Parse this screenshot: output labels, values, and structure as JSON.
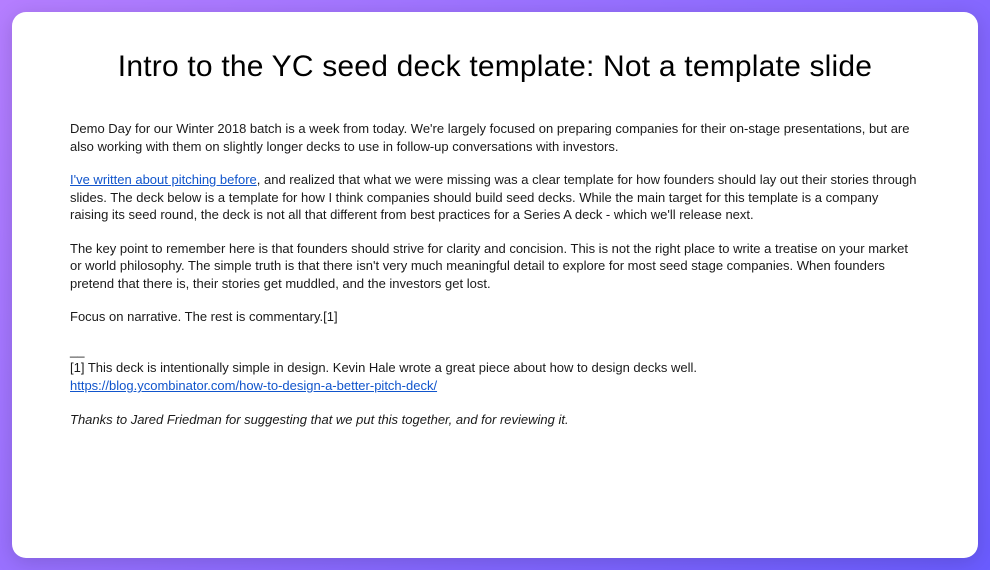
{
  "title": "Intro to the YC seed deck template: Not a template slide",
  "para1": "Demo Day for our Winter 2018 batch is a week from today. We're largely focused on preparing companies for their on-stage presentations, but are also working with them on slightly longer decks to use in follow-up conversations with investors.",
  "para2_link": "I've written about pitching before",
  "para2_rest": ", and realized that what we were missing was a clear template for how founders should lay out their stories through slides. The deck below is a template for how I think companies should build seed decks. While the main target for this template is a company raising its seed round, the deck is not all that different from best practices for a Series A deck - which we'll release next.",
  "para3": "The key point to remember here is that founders should strive for clarity and concision. This is not the right place to write a treatise on your market or world philosophy. The simple truth is that there isn't very much meaningful detail to explore for most seed stage companies. When founders pretend that there is, their stories get muddled, and the investors get lost.",
  "para4": "Focus on narrative. The rest is commentary.[1]",
  "footnote_divider": "__",
  "footnote_text": "[1] This deck is intentionally simple in design. Kevin Hale wrote a great piece about how to design decks well.",
  "footnote_link": "https://blog.ycombinator.com/how-to-design-a-better-pitch-deck/",
  "thanks": "Thanks to Jared Friedman for suggesting that we put this together, and for reviewing it."
}
